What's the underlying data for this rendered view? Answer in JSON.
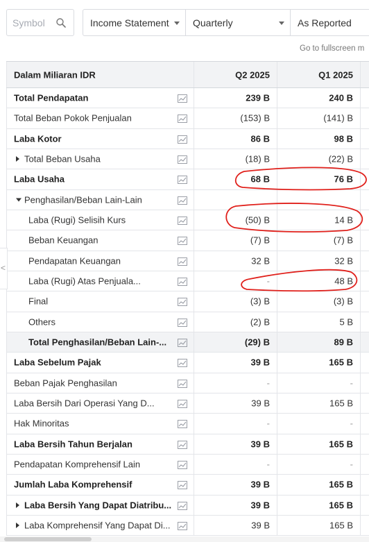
{
  "toolbar": {
    "search_placeholder": "Symbol",
    "statement_select": "Income Statement",
    "period_select": "Quarterly",
    "type_select": "As Reported",
    "fullscreen_link": "Go to fullscreen m"
  },
  "table": {
    "header_label": "Dalam Miliaran IDR",
    "columns": [
      "Q2 2025",
      "Q1 2025"
    ],
    "rows": [
      {
        "label": "Total Pendapatan",
        "bold": true,
        "q2": "239 B",
        "q1": "240 B"
      },
      {
        "label": "Total Beban Pokok Penjualan",
        "q2": "(153) B",
        "q1": "(141) B"
      },
      {
        "label": "Laba Kotor",
        "bold": true,
        "q2": "86 B",
        "q1": "98 B"
      },
      {
        "label": "Total Beban Usaha",
        "toggle": "collapsed",
        "q2": "(18) B",
        "q1": "(22) B"
      },
      {
        "label": "Laba Usaha",
        "bold": true,
        "q2": "68 B",
        "q1": "76 B"
      },
      {
        "label": "Penghasilan/Beban Lain-Lain",
        "toggle": "expanded",
        "q2": "",
        "q1": ""
      },
      {
        "label": "Laba (Rugi) Selisih Kurs",
        "indent": true,
        "q2": "(50) B",
        "q1": "14 B"
      },
      {
        "label": "Beban Keuangan",
        "indent": true,
        "q2": "(7) B",
        "q1": "(7) B"
      },
      {
        "label": "Pendapatan Keuangan",
        "indent": true,
        "q2": "32 B",
        "q1": "32 B"
      },
      {
        "label": "Laba (Rugi) Atas Penjuala...",
        "indent": true,
        "q2": "-",
        "q1": "48 B"
      },
      {
        "label": "Final",
        "indent": true,
        "q2": "(3) B",
        "q1": "(3) B"
      },
      {
        "label": "Others",
        "indent": true,
        "q2": "(2) B",
        "q1": "5 B"
      },
      {
        "label": "Total Penghasilan/Beban Lain-...",
        "indent": true,
        "bold": true,
        "shaded": true,
        "q2": "(29) B",
        "q1": "89 B"
      },
      {
        "label": "Laba Sebelum Pajak",
        "bold": true,
        "q2": "39 B",
        "q1": "165 B"
      },
      {
        "label": "Beban Pajak Penghasilan",
        "q2": "-",
        "q1": "-"
      },
      {
        "label": "Laba Bersih Dari Operasi Yang D...",
        "q2": "39 B",
        "q1": "165 B"
      },
      {
        "label": "Hak Minoritas",
        "q2": "-",
        "q1": "-"
      },
      {
        "label": "Laba Bersih Tahun Berjalan",
        "bold": true,
        "q2": "39 B",
        "q1": "165 B"
      },
      {
        "label": "Pendapatan Komprehensif Lain",
        "q2": "-",
        "q1": "-"
      },
      {
        "label": "Jumlah Laba Komprehensif",
        "bold": true,
        "q2": "39 B",
        "q1": "165 B"
      },
      {
        "label": "Laba Bersih Yang Dapat Diatribu...",
        "bold": true,
        "toggle": "collapsed",
        "q2": "39 B",
        "q1": "165 B"
      },
      {
        "label": "Laba Komprehensif Yang Dapat Di...",
        "toggle": "collapsed",
        "q2": "39 B",
        "q1": "165 B"
      }
    ]
  },
  "side_tab": "<",
  "colors": {
    "annotation": "#e0201b",
    "header_bg": "#f2f3f5",
    "border": "#e3e5e9"
  }
}
